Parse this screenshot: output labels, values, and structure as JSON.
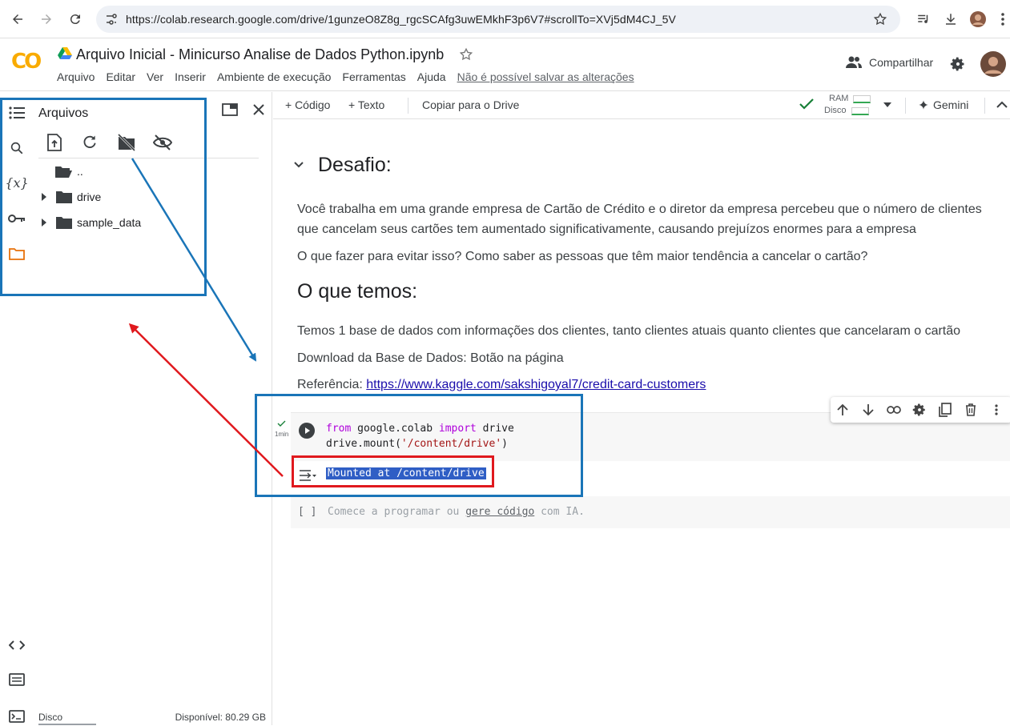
{
  "browser": {
    "url": "https://colab.research.google.com/drive/1gunzeO8Z8g_rgcSCAfg3uwEMkhF3p6V7#scrollTo=XVj5dM4CJ_5V"
  },
  "header": {
    "logo": "CO",
    "title": "Arquivo Inicial - Minicurso Analise de Dados Python.ipynb",
    "menu": [
      "Arquivo",
      "Editar",
      "Ver",
      "Inserir",
      "Ambiente de execução",
      "Ferramentas",
      "Ajuda"
    ],
    "save_warning": "Não é possível salvar as alterações",
    "share_label": "Compartilhar"
  },
  "panel": {
    "title": "Arquivos",
    "tree": [
      {
        "label": ".."
      },
      {
        "label": "drive"
      },
      {
        "label": "sample_data"
      }
    ],
    "disk_label": "Disco",
    "disk_available": "Disponível: 80.29 GB"
  },
  "toolbar": {
    "code_label": "+ Código",
    "text_label": "+ Texto",
    "drive_copy_label": "Copiar para o Drive",
    "ram_label": "RAM",
    "disk_label": "Disco",
    "gemini_label": "Gemini"
  },
  "content": {
    "heading": "Desafio:",
    "para1": "Você trabalha em uma grande empresa de Cartão de Crédito e o diretor da empresa percebeu que o número de clientes que cancelam seus cartões tem aumentado significativamente, causando prejuízos enormes para a empresa",
    "para2": "O que fazer para evitar isso? Como saber as pessoas que têm maior tendência a cancelar o cartão?",
    "h2": "O que temos:",
    "para3": "Temos 1 base de dados com informações dos clientes, tanto clientes atuais quanto clientes que cancelaram o cartão",
    "para4": "Download da Base de Dados: Botão na página",
    "ref_label": "Referência: ",
    "ref_link": "https://www.kaggle.com/sakshigoyal7/credit-card-customers",
    "cell_exec_time": "1min",
    "code_line1_kw1": "from",
    "code_line1_mod": " google.colab ",
    "code_line1_kw2": "import",
    "code_line1_name": " drive",
    "code_line2_pre": "drive.mount(",
    "code_line2_str": "'/content/drive'",
    "code_line2_post": ")",
    "output": "Mounted at /content/drive",
    "empty_cell_brackets": "[ ]",
    "empty_cell_pre": "Comece a programar ou ",
    "empty_cell_link": "gere código",
    "empty_cell_post": " com IA."
  },
  "colors": {
    "annotation_blue": "#1a75b8",
    "annotation_red": "#e0191e",
    "accent_orange": "#f9ab00",
    "output_highlight": "#2f5ec5"
  }
}
